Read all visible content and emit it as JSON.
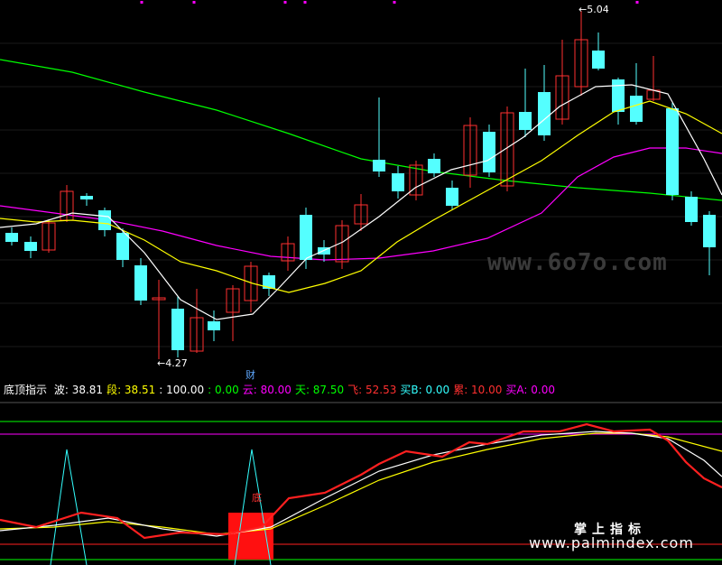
{
  "price_labels": {
    "high": "5.04",
    "low": "4.27",
    "marker": "财"
  },
  "indicator": {
    "name": "底顶指示",
    "items": [
      {
        "label": "波:",
        "value": "38.81",
        "color": "#ffffff"
      },
      {
        "label": "段:",
        "value": "38.51",
        "color": "#ffff00"
      },
      {
        "label": ":",
        "value": "100.00",
        "color": "#ffffff"
      },
      {
        "label": ":",
        "value": "0.00",
        "color": "#00ff00"
      },
      {
        "label": "云:",
        "value": "80.00",
        "color": "#ff00ff"
      },
      {
        "label": "天:",
        "value": "87.50",
        "color": "#00ff00"
      },
      {
        "label": "飞:",
        "value": "52.53",
        "color": "#ff3030"
      },
      {
        "label": "买B:",
        "value": "0.00",
        "color": "#33ffff"
      },
      {
        "label": "累:",
        "value": "10.00",
        "color": "#ff3030"
      },
      {
        "label": "买A:",
        "value": "0.00",
        "color": "#ff00ff"
      }
    ],
    "zone_label": "底"
  },
  "watermarks": {
    "top": "www.6o7o.com",
    "brand": "掌上指标",
    "url": "www.palmindex.com"
  },
  "colors": {
    "up": "#ff3030",
    "down": "#54ffff",
    "ma5": "#ffffff",
    "ma10": "#ffff00",
    "ma30": "#ff00ff",
    "ma60": "#00ff00"
  }
}
